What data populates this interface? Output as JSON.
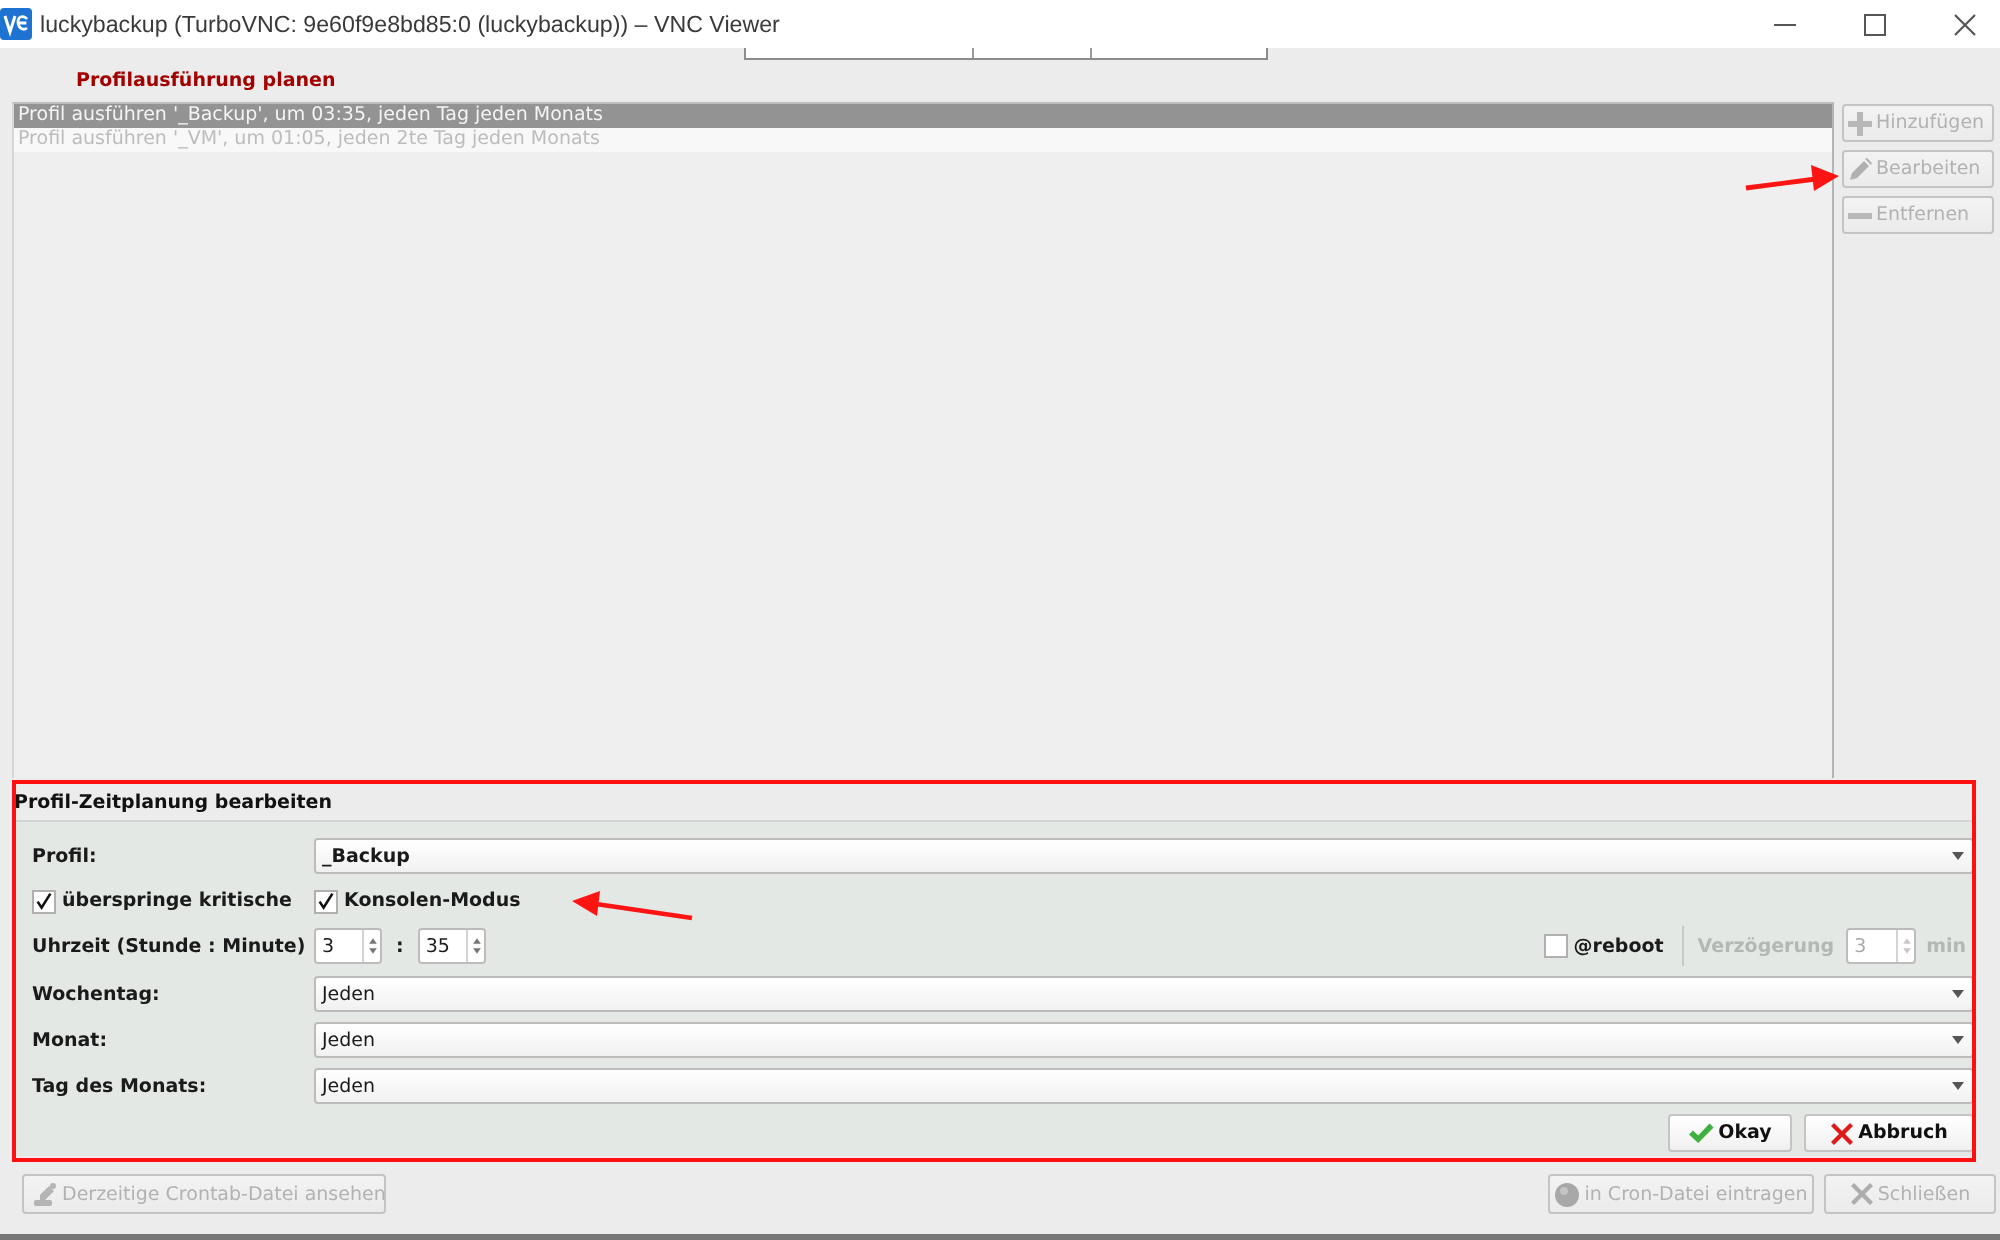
{
  "window": {
    "title": "luckybackup (TurboVNC: 9e60f9e8bd85:0 (luckybackup)) – VNC Viewer"
  },
  "schedule": {
    "heading": "Profilausführung planen",
    "rows": [
      {
        "text": "Profil ausführen '_Backup', um 03:35, jeden Tag jeden Monats",
        "selected": true,
        "disabled": false
      },
      {
        "text": "Profil ausführen '_VM', um 01:05, jeden 2te Tag jeden Monats",
        "selected": false,
        "disabled": true
      }
    ],
    "buttons": [
      {
        "label": "Hinzufügen",
        "kind": "add",
        "disabled": true
      },
      {
        "label": "Bearbeiten",
        "kind": "edit",
        "disabled": true
      },
      {
        "label": "Entfernen",
        "kind": "remove",
        "disabled": true
      }
    ]
  },
  "editor": {
    "title": "Profil-Zeitplanung bearbeiten",
    "profile": {
      "label": "Profil:",
      "value": "_Backup"
    },
    "options": [
      {
        "label": "überspringe kritische",
        "checked": true
      },
      {
        "label": "Konsolen-Modus",
        "checked": true
      }
    ],
    "time": {
      "label": "Uhrzeit (Stunde : Minute)",
      "hour": "3",
      "separator": ":",
      "minute": "35"
    },
    "reboot": {
      "label": "@reboot",
      "checked": false
    },
    "delay": {
      "label": "Verzögerung",
      "value": "3",
      "unit": "min",
      "disabled": true
    },
    "selects": [
      {
        "label": "Wochentag:",
        "value": "Jeden"
      },
      {
        "label": "Monat:",
        "value": "Jeden"
      },
      {
        "label": "Tag des Monats:",
        "value": "Jeden"
      }
    ],
    "buttons": [
      {
        "label": "Okay",
        "kind": "ok",
        "disabled": false
      },
      {
        "label": "Abbruch",
        "kind": "cancel",
        "disabled": false
      }
    ]
  },
  "footer": {
    "buttons": [
      {
        "label": "Derzeitige Crontab-Datei ansehen",
        "kind": "view",
        "disabled": true
      },
      {
        "label": "in Cron-Datei eintragen",
        "kind": "write",
        "disabled": true
      },
      {
        "label": "Schließen",
        "kind": "close",
        "disabled": true
      }
    ]
  }
}
